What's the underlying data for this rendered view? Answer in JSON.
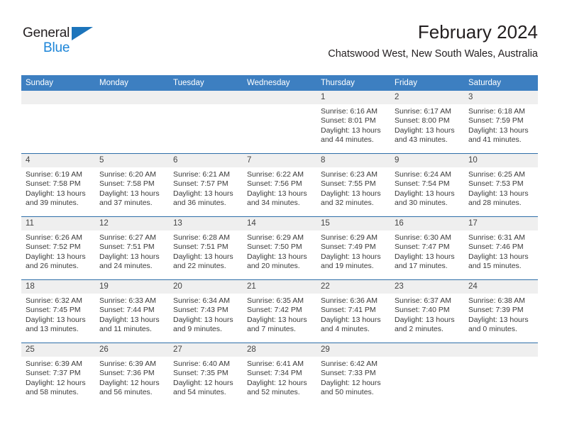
{
  "brand": {
    "name_top": "General",
    "name_bottom": "Blue",
    "accent_color": "#1c85d8",
    "triangle_color": "#1c74bb"
  },
  "header": {
    "title": "February 2024",
    "subtitle": "Chatswood West, New South Wales, Australia"
  },
  "theme": {
    "header_row_bg": "#3d7fc1",
    "date_band_bg": "#efefef",
    "row_separator": "#2f6fa8",
    "text_color": "#333333"
  },
  "weekdays": [
    "Sunday",
    "Monday",
    "Tuesday",
    "Wednesday",
    "Thursday",
    "Friday",
    "Saturday"
  ],
  "weeks": [
    [
      {
        "day": "",
        "empty": true
      },
      {
        "day": "",
        "empty": true
      },
      {
        "day": "",
        "empty": true
      },
      {
        "day": "",
        "empty": true
      },
      {
        "day": "1",
        "sunrise": "Sunrise: 6:16 AM",
        "sunset": "Sunset: 8:01 PM",
        "daylight": "Daylight: 13 hours and 44 minutes."
      },
      {
        "day": "2",
        "sunrise": "Sunrise: 6:17 AM",
        "sunset": "Sunset: 8:00 PM",
        "daylight": "Daylight: 13 hours and 43 minutes."
      },
      {
        "day": "3",
        "sunrise": "Sunrise: 6:18 AM",
        "sunset": "Sunset: 7:59 PM",
        "daylight": "Daylight: 13 hours and 41 minutes."
      }
    ],
    [
      {
        "day": "4",
        "sunrise": "Sunrise: 6:19 AM",
        "sunset": "Sunset: 7:58 PM",
        "daylight": "Daylight: 13 hours and 39 minutes."
      },
      {
        "day": "5",
        "sunrise": "Sunrise: 6:20 AM",
        "sunset": "Sunset: 7:58 PM",
        "daylight": "Daylight: 13 hours and 37 minutes."
      },
      {
        "day": "6",
        "sunrise": "Sunrise: 6:21 AM",
        "sunset": "Sunset: 7:57 PM",
        "daylight": "Daylight: 13 hours and 36 minutes."
      },
      {
        "day": "7",
        "sunrise": "Sunrise: 6:22 AM",
        "sunset": "Sunset: 7:56 PM",
        "daylight": "Daylight: 13 hours and 34 minutes."
      },
      {
        "day": "8",
        "sunrise": "Sunrise: 6:23 AM",
        "sunset": "Sunset: 7:55 PM",
        "daylight": "Daylight: 13 hours and 32 minutes."
      },
      {
        "day": "9",
        "sunrise": "Sunrise: 6:24 AM",
        "sunset": "Sunset: 7:54 PM",
        "daylight": "Daylight: 13 hours and 30 minutes."
      },
      {
        "day": "10",
        "sunrise": "Sunrise: 6:25 AM",
        "sunset": "Sunset: 7:53 PM",
        "daylight": "Daylight: 13 hours and 28 minutes."
      }
    ],
    [
      {
        "day": "11",
        "sunrise": "Sunrise: 6:26 AM",
        "sunset": "Sunset: 7:52 PM",
        "daylight": "Daylight: 13 hours and 26 minutes."
      },
      {
        "day": "12",
        "sunrise": "Sunrise: 6:27 AM",
        "sunset": "Sunset: 7:51 PM",
        "daylight": "Daylight: 13 hours and 24 minutes."
      },
      {
        "day": "13",
        "sunrise": "Sunrise: 6:28 AM",
        "sunset": "Sunset: 7:51 PM",
        "daylight": "Daylight: 13 hours and 22 minutes."
      },
      {
        "day": "14",
        "sunrise": "Sunrise: 6:29 AM",
        "sunset": "Sunset: 7:50 PM",
        "daylight": "Daylight: 13 hours and 20 minutes."
      },
      {
        "day": "15",
        "sunrise": "Sunrise: 6:29 AM",
        "sunset": "Sunset: 7:49 PM",
        "daylight": "Daylight: 13 hours and 19 minutes."
      },
      {
        "day": "16",
        "sunrise": "Sunrise: 6:30 AM",
        "sunset": "Sunset: 7:47 PM",
        "daylight": "Daylight: 13 hours and 17 minutes."
      },
      {
        "day": "17",
        "sunrise": "Sunrise: 6:31 AM",
        "sunset": "Sunset: 7:46 PM",
        "daylight": "Daylight: 13 hours and 15 minutes."
      }
    ],
    [
      {
        "day": "18",
        "sunrise": "Sunrise: 6:32 AM",
        "sunset": "Sunset: 7:45 PM",
        "daylight": "Daylight: 13 hours and 13 minutes."
      },
      {
        "day": "19",
        "sunrise": "Sunrise: 6:33 AM",
        "sunset": "Sunset: 7:44 PM",
        "daylight": "Daylight: 13 hours and 11 minutes."
      },
      {
        "day": "20",
        "sunrise": "Sunrise: 6:34 AM",
        "sunset": "Sunset: 7:43 PM",
        "daylight": "Daylight: 13 hours and 9 minutes."
      },
      {
        "day": "21",
        "sunrise": "Sunrise: 6:35 AM",
        "sunset": "Sunset: 7:42 PM",
        "daylight": "Daylight: 13 hours and 7 minutes."
      },
      {
        "day": "22",
        "sunrise": "Sunrise: 6:36 AM",
        "sunset": "Sunset: 7:41 PM",
        "daylight": "Daylight: 13 hours and 4 minutes."
      },
      {
        "day": "23",
        "sunrise": "Sunrise: 6:37 AM",
        "sunset": "Sunset: 7:40 PM",
        "daylight": "Daylight: 13 hours and 2 minutes."
      },
      {
        "day": "24",
        "sunrise": "Sunrise: 6:38 AM",
        "sunset": "Sunset: 7:39 PM",
        "daylight": "Daylight: 13 hours and 0 minutes."
      }
    ],
    [
      {
        "day": "25",
        "sunrise": "Sunrise: 6:39 AM",
        "sunset": "Sunset: 7:37 PM",
        "daylight": "Daylight: 12 hours and 58 minutes."
      },
      {
        "day": "26",
        "sunrise": "Sunrise: 6:39 AM",
        "sunset": "Sunset: 7:36 PM",
        "daylight": "Daylight: 12 hours and 56 minutes."
      },
      {
        "day": "27",
        "sunrise": "Sunrise: 6:40 AM",
        "sunset": "Sunset: 7:35 PM",
        "daylight": "Daylight: 12 hours and 54 minutes."
      },
      {
        "day": "28",
        "sunrise": "Sunrise: 6:41 AM",
        "sunset": "Sunset: 7:34 PM",
        "daylight": "Daylight: 12 hours and 52 minutes."
      },
      {
        "day": "29",
        "sunrise": "Sunrise: 6:42 AM",
        "sunset": "Sunset: 7:33 PM",
        "daylight": "Daylight: 12 hours and 50 minutes."
      },
      {
        "day": "",
        "empty": true
      },
      {
        "day": "",
        "empty": true
      }
    ]
  ]
}
